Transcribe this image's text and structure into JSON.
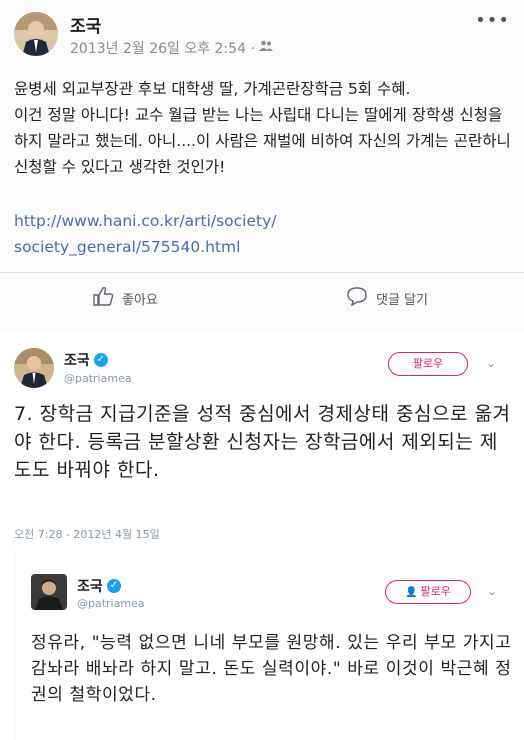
{
  "facebook": {
    "name": "조국",
    "meta": "2013년 2월 26일 오후 2:54 ·",
    "body": "윤병세 외교부장관 후보 대학생 딸, 가계곤란장학금 5회 수혜.\n이건 정말 아니다! 교수 월급 받는 나는 사립대 다니는 딸에게 장학생 신청을 하지 말라고 했는데. 아니....이 사람은 재벌에 비하여 자신의 가계는 곤란하니 신청할 수 있다고 생각한 것인가!",
    "link": "http://www.hani.co.kr/arti/society/\nsociety_general/575540.html",
    "like_label": "좋아요",
    "comment_label": "댓글 달기"
  },
  "tweet": {
    "name": "조국",
    "handle": "@patriamea",
    "follow_label": "팔로우",
    "text": "7. 장학금 지급기준을 성적 중심에서 경제상태 중심으로 옮겨야 한다. 등록금 분할상환 신청자는 장학금에서 제외되는 제도도 바꿔야 한다.",
    "time": "오전 7:28 - 2012년 4월 15일"
  },
  "quoted": {
    "name": "조국",
    "handle": "@patriamea",
    "follow_label": "팔로우",
    "text": "정유라, \"능력 없으면 니네 부모를 원망해. 있는 우리 부모 가지고 감놔라 배놔라 하지 말고. 돈도 실력이야.\" 바로 이것이 박근혜 정권의 철학이었다."
  },
  "colors": {
    "link": "#4b6bb0",
    "follow": "#e0245e",
    "verified": "#1da1f2"
  }
}
